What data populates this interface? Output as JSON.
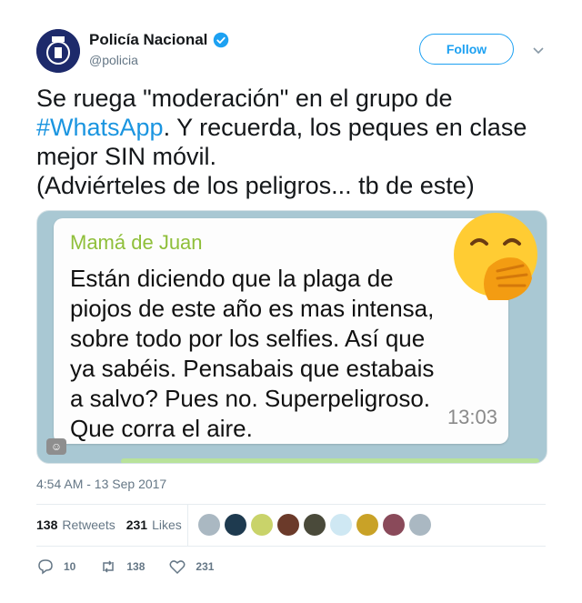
{
  "header": {
    "display_name": "Policía Nacional",
    "handle": "@policia",
    "follow_label": "Follow"
  },
  "tweet": {
    "line1": "Se ruega \"moderación\" en el grupo de",
    "hashtag": "#WhatsApp",
    "line2_rest": ". Y recuerda, los peques en clase",
    "line3": "mejor SIN móvil.",
    "line4": "(Adviérteles de los peligros... tb de este)"
  },
  "media": {
    "author": "Mamá de Juan",
    "lines": [
      "Están diciendo que la plaga de",
      "piojos de este año es mas intensa,",
      "sobre todo por los selfies. Así que",
      "ya sabéis. Pensabais que estabais",
      "a salvo? Pues no. Superpeligroso.",
      "Que corra el aire."
    ],
    "time": "13:03",
    "badge": "☺"
  },
  "timestamp": "4:54 AM - 13 Sep 2017",
  "stats": {
    "retweets_count": "138",
    "retweets_label": "Retweets",
    "likes_count": "231",
    "likes_label": "Likes"
  },
  "actions": {
    "reply_count": "10",
    "retweet_count": "138",
    "like_count": "231"
  },
  "colors": {
    "accent": "#1da1f2",
    "hashtag": "#1b95e0",
    "muted": "#657786"
  }
}
